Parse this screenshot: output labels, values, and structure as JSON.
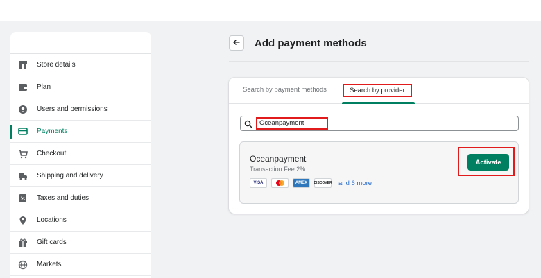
{
  "page": {
    "title": "Add payment methods"
  },
  "sidebar": {
    "items": [
      {
        "label": "Store details",
        "icon": "store-icon"
      },
      {
        "label": "Plan",
        "icon": "plan-icon"
      },
      {
        "label": "Users and permissions",
        "icon": "user-icon"
      },
      {
        "label": "Payments",
        "icon": "payments-icon",
        "active": true
      },
      {
        "label": "Checkout",
        "icon": "cart-icon"
      },
      {
        "label": "Shipping and delivery",
        "icon": "truck-icon"
      },
      {
        "label": "Taxes and duties",
        "icon": "tax-icon"
      },
      {
        "label": "Locations",
        "icon": "location-pin-icon"
      },
      {
        "label": "Gift cards",
        "icon": "gift-icon"
      },
      {
        "label": "Markets",
        "icon": "globe-icon"
      }
    ]
  },
  "tabs": [
    {
      "label": "Search by payment methods"
    },
    {
      "label": "Search by provider",
      "active": true
    }
  ],
  "search": {
    "value": "Oceanpayment"
  },
  "provider": {
    "name": "Oceanpayment",
    "fee": "Transaction Fee 2%",
    "cards": [
      "VISA",
      "Mastercard",
      "AMEX",
      "DISCOVER"
    ],
    "more_label": "and 6 more",
    "action_label": "Activate"
  },
  "colors": {
    "accent": "#008060",
    "highlight": "#e11b1b",
    "link": "#2c6ecb"
  }
}
